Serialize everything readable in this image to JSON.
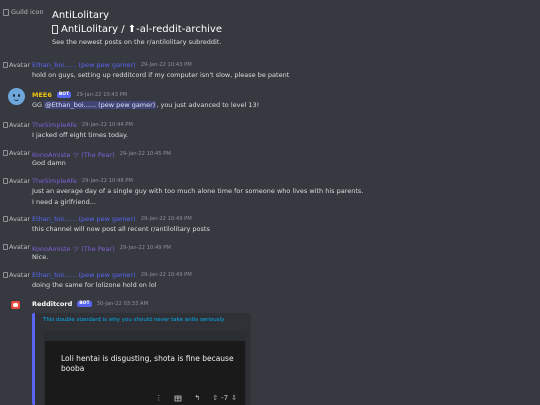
{
  "header": {
    "guild_icon_alt": "Guild icon",
    "guild_name": "AntiLolitary",
    "channel_path": "AntiLolitary / ⬆-al-reddit-archive",
    "channel_description": "See the newest posts on the r/antilolitary subreddit."
  },
  "avatar_alt": "Avatar",
  "messages": [
    {
      "user": "Ethan_boi...... (pew pew gamer)",
      "time": "29-Jan-22 10:43 PM",
      "text": "hold on guys, setting up redditcord if my computer isn't slow, please be patent"
    },
    {
      "user": "MEE6",
      "bot": "BOT",
      "time": "29-Jan-22 10:43 PM",
      "text_pre": "GG ",
      "mention": "@Ethan_boi...... (pew pew gamer)",
      "text_post": ", you just advanced to level 13!"
    },
    {
      "user": "TheSimpleAfe",
      "time": "29-Jan-22 10:44 PM",
      "text": "I jacked off eight times today."
    },
    {
      "user": "KonoAmiste ツ (The Pear)",
      "time": "29-Jan-22 10:45 PM",
      "text": "God damn"
    },
    {
      "user": "TheSimpleAfe",
      "time": "29-Jan-22 10:48 PM",
      "text": "Just an average day of a single guy with too much alone time for someone who lives with his parents.",
      "text2": "I need a girlfriend..."
    },
    {
      "user": "Ethan_boi...... (pew pew gamer)",
      "time": "29-Jan-22 10:49 PM",
      "text": "this channel will now post all recent r/antilolitary posts"
    },
    {
      "user": "KonoAmiste ツ (The Pear)",
      "time": "29-Jan-22 10:49 PM",
      "text": "Nice."
    },
    {
      "user": "Ethan_boi...... (pew pew gamer)",
      "time": "29-Jan-22 10:49 PM",
      "text": "doing the same for lolizone hold on lol"
    },
    {
      "user": "Redditcord",
      "bot": "BOT",
      "time": "30-Jan-22 03:33 AM"
    }
  ],
  "embed": {
    "title": "This double standard is why you should never take antis seriously",
    "post_text": "Loli hentai is disgusting, shota is fine because booba",
    "icons": [
      "more-icon",
      "award-icon",
      "share-icon",
      "upvote-icon",
      "downvote-icon"
    ],
    "score": "-7"
  },
  "colors": {
    "background": "#36393f",
    "blurple": "#5865f2",
    "mee6": "#f1c40f",
    "embed_bg": "#2f3136"
  }
}
